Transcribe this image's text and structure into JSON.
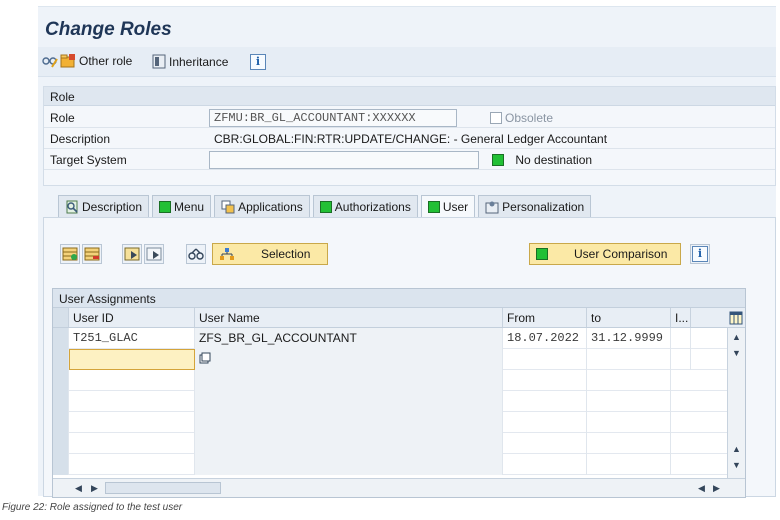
{
  "window": {
    "title": "Change Roles"
  },
  "toolbar": {
    "other_role": "Other role",
    "inheritance": "Inheritance",
    "info_icon": "i"
  },
  "role": {
    "section_title": "Role",
    "role_label": "Role",
    "role_value": "ZFMU:BR_GL_ACCOUNTANT:XXXXXX",
    "obsolete_label": "Obsolete",
    "description_label": "Description",
    "description_value": "CBR:GLOBAL:FIN:RTR:UPDATE/CHANGE: - General Ledger Accountant",
    "target_label": "Target System",
    "target_value": "",
    "no_destination": "No destination",
    "status_color": "#22c035"
  },
  "tabs": [
    {
      "label": "Description",
      "icon": "description-icon"
    },
    {
      "label": "Menu",
      "icon": "green-square-icon"
    },
    {
      "label": "Applications",
      "icon": "applications-icon"
    },
    {
      "label": "Authorizations",
      "icon": "green-square-icon"
    },
    {
      "label": "User",
      "icon": "green-square-icon",
      "active": true
    },
    {
      "label": "Personalization",
      "icon": "personalization-icon"
    }
  ],
  "user_tab": {
    "selection_label": "Selection",
    "user_comparison_label": "User Comparison",
    "info_icon": "i"
  },
  "assignments": {
    "title": "User Assignments",
    "columns": {
      "user_id": "User ID",
      "user_name": "User Name",
      "from": "From",
      "to": "to",
      "extra": "I..."
    },
    "rows": [
      {
        "user_id": "T251_GLAC",
        "user_name": "ZFS_BR_GL_ACCOUNTANT",
        "from": "18.07.2022",
        "to": "31.12.9999"
      }
    ]
  },
  "caption": "Figure 22: Role assigned to the test user"
}
